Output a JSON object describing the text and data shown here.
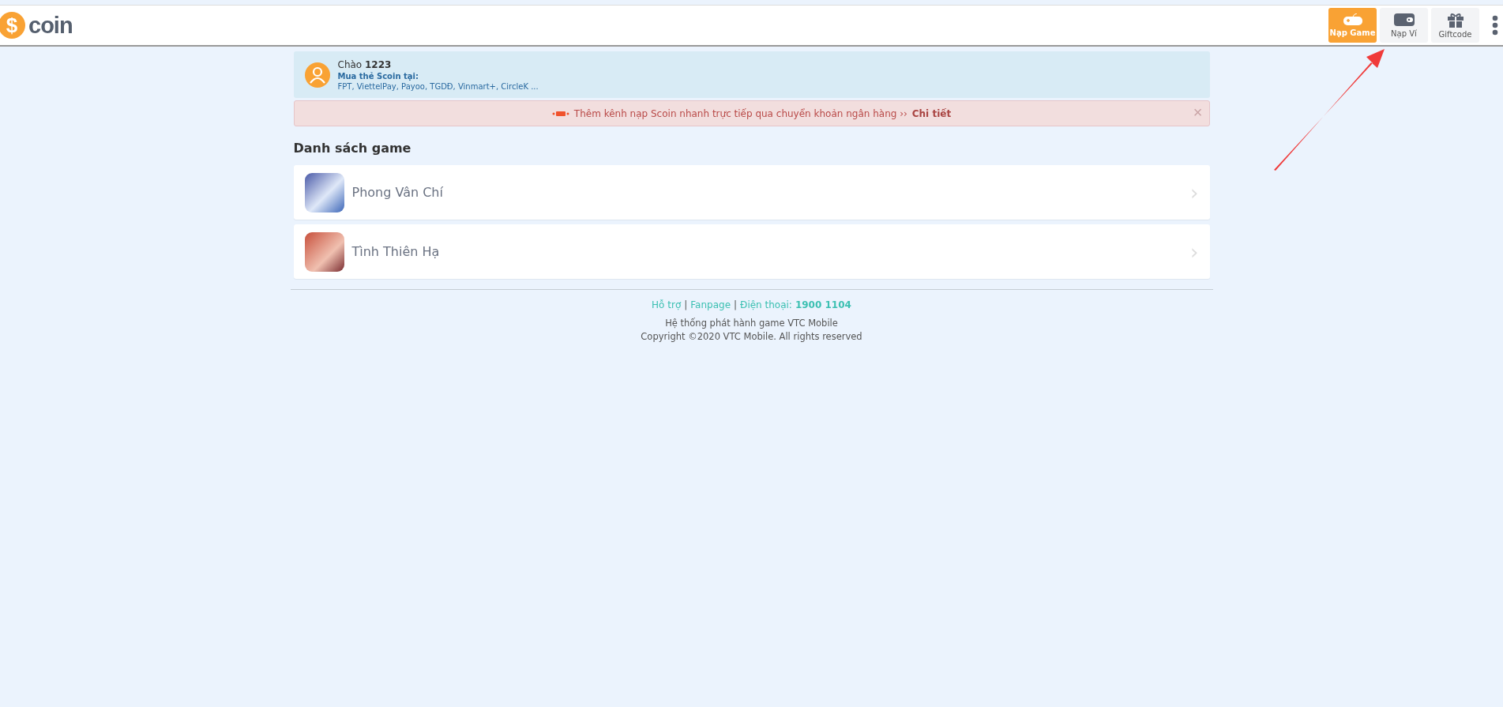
{
  "header": {
    "logo_symbol": "$",
    "logo_text": "coin",
    "nav": [
      {
        "kind": "gamepad",
        "label": "Nạp Game",
        "selected": true
      },
      {
        "kind": "wallet",
        "label": "Nạp Ví",
        "selected": false
      },
      {
        "kind": "gift",
        "label": "Giftcode",
        "selected": false
      }
    ]
  },
  "welcome": {
    "greeting": "Chào",
    "user": "1223",
    "buy_title": "Mua thẻ Scoin tại:",
    "stores": "FPT, ViettelPay, Payoo, TGDĐ, Vinmart+, CircleK ..."
  },
  "alert": {
    "text": "Thêm kênh nạp Scoin nhanh trực tiếp qua chuyển khoản ngân hàng ››",
    "link": "Chi tiết",
    "close": "×"
  },
  "games_title": "Danh sách game",
  "games": [
    {
      "name": "Phong Vân Chí",
      "chevron": "›"
    },
    {
      "name": "Tình Thiên Hạ",
      "chevron": "›"
    }
  ],
  "footer": {
    "links": [
      "Hỗ trợ",
      "Fanpage"
    ],
    "separator": "|",
    "phone_label": "Điện thoại:",
    "phone": "1900 1104",
    "line1": "Hệ thống phát hành game VTC Mobile",
    "line2": "Copyright ©2020 VTC Mobile. All rights reserved"
  }
}
